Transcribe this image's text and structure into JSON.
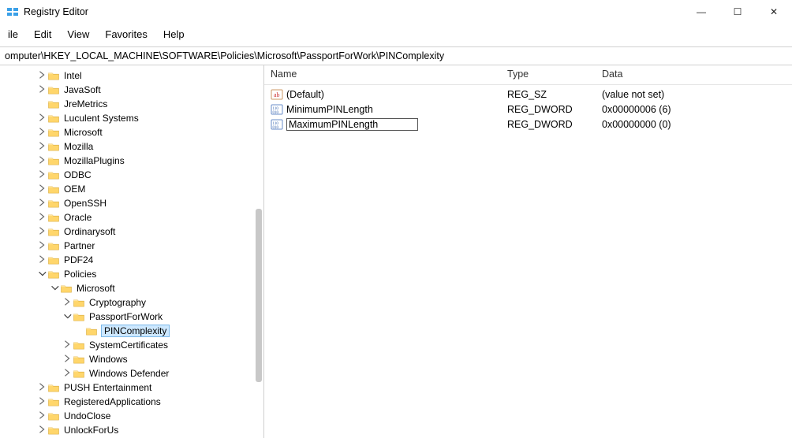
{
  "title": "Registry Editor",
  "window_controls": {
    "min": "—",
    "max": "☐",
    "close": "✕"
  },
  "menu": {
    "file": "ile",
    "edit": "Edit",
    "view": "View",
    "favorites": "Favorites",
    "help": "Help"
  },
  "address": "omputer\\HKEY_LOCAL_MACHINE\\SOFTWARE\\Policies\\Microsoft\\PassportForWork\\PINComplexity",
  "columns": {
    "name": "Name",
    "type": "Type",
    "data": "Data"
  },
  "values": [
    {
      "icon": "str",
      "name": "(Default)",
      "type": "REG_SZ",
      "data": "(value not set)",
      "editing": false
    },
    {
      "icon": "bin",
      "name": "MinimumPINLength",
      "type": "REG_DWORD",
      "data": "0x00000006 (6)",
      "editing": false
    },
    {
      "icon": "bin",
      "name": "MaximumPINLength",
      "type": "REG_DWORD",
      "data": "0x00000000 (0)",
      "editing": true
    }
  ],
  "tree": [
    {
      "indent": 46,
      "exp": ">",
      "label": "Intel"
    },
    {
      "indent": 46,
      "exp": ">",
      "label": "JavaSoft"
    },
    {
      "indent": 46,
      "exp": "",
      "label": "JreMetrics"
    },
    {
      "indent": 46,
      "exp": ">",
      "label": "Luculent Systems"
    },
    {
      "indent": 46,
      "exp": ">",
      "label": "Microsoft"
    },
    {
      "indent": 46,
      "exp": ">",
      "label": "Mozilla"
    },
    {
      "indent": 46,
      "exp": ">",
      "label": "MozillaPlugins"
    },
    {
      "indent": 46,
      "exp": ">",
      "label": "ODBC"
    },
    {
      "indent": 46,
      "exp": ">",
      "label": "OEM"
    },
    {
      "indent": 46,
      "exp": ">",
      "label": "OpenSSH"
    },
    {
      "indent": 46,
      "exp": ">",
      "label": "Oracle"
    },
    {
      "indent": 46,
      "exp": ">",
      "label": "Ordinarysoft"
    },
    {
      "indent": 46,
      "exp": ">",
      "label": "Partner"
    },
    {
      "indent": 46,
      "exp": ">",
      "label": "PDF24"
    },
    {
      "indent": 46,
      "exp": "v",
      "label": "Policies"
    },
    {
      "indent": 62,
      "exp": "v",
      "label": "Microsoft"
    },
    {
      "indent": 78,
      "exp": ">",
      "label": "Cryptography"
    },
    {
      "indent": 78,
      "exp": "v",
      "label": "PassportForWork"
    },
    {
      "indent": 94,
      "exp": "",
      "label": "PINComplexity",
      "selected": true
    },
    {
      "indent": 78,
      "exp": ">",
      "label": "SystemCertificates"
    },
    {
      "indent": 78,
      "exp": ">",
      "label": "Windows"
    },
    {
      "indent": 78,
      "exp": ">",
      "label": "Windows Defender"
    },
    {
      "indent": 46,
      "exp": ">",
      "label": "PUSH Entertainment"
    },
    {
      "indent": 46,
      "exp": ">",
      "label": "RegisteredApplications"
    },
    {
      "indent": 46,
      "exp": ">",
      "label": "UndoClose"
    },
    {
      "indent": 46,
      "exp": ">",
      "label": "UnlockForUs"
    }
  ]
}
